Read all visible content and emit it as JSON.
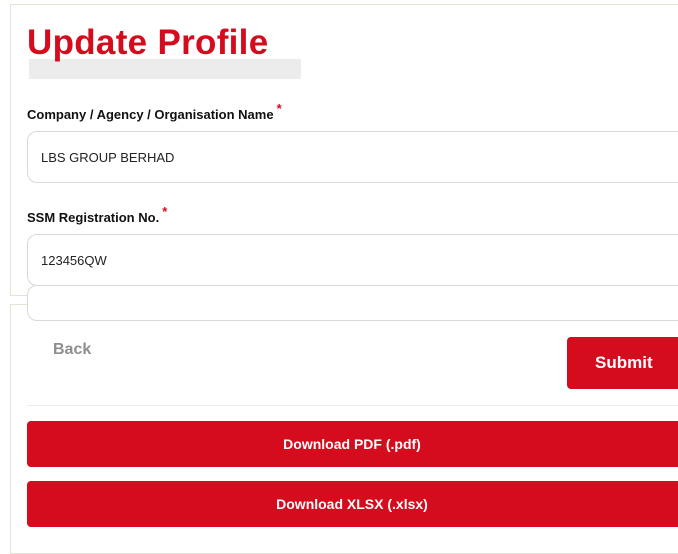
{
  "page": {
    "title": "Update Profile"
  },
  "form": {
    "company": {
      "label": "Company / Agency / Organisation Name",
      "required_mark": "*",
      "value": "LBS GROUP BERHAD"
    },
    "ssm": {
      "label": "SSM Registration No.",
      "required_mark": "*",
      "value": "123456QW"
    }
  },
  "actions": {
    "back_label": "Back",
    "submit_label": "Submit",
    "download_pdf_label": "Download PDF (.pdf)",
    "download_xlsx_label": "Download XLSX (.xlsx)"
  },
  "colors": {
    "accent": "#d50b1e",
    "muted_text": "#8e8e8e"
  }
}
